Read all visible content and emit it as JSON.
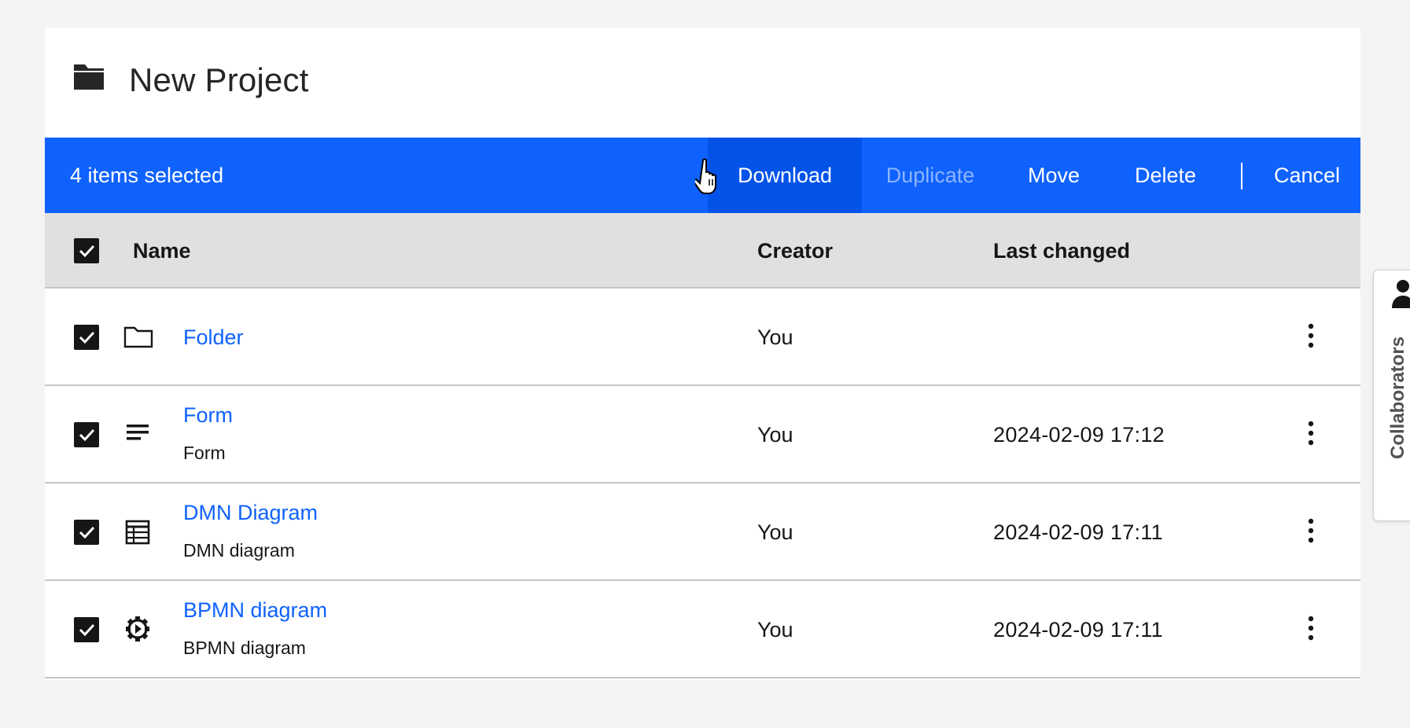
{
  "header": {
    "title": "New Project",
    "icon": "folder-filled-icon"
  },
  "toolbar": {
    "selected_count_text": "4 items selected",
    "download": "Download",
    "duplicate": "Duplicate",
    "move": "Move",
    "delete": "Delete",
    "cancel": "Cancel"
  },
  "table": {
    "headers": {
      "name": "Name",
      "creator": "Creator",
      "last_changed": "Last changed"
    },
    "rows": [
      {
        "name": "Folder",
        "type": "",
        "creator": "You",
        "last_changed": "",
        "icon": "folder-icon"
      },
      {
        "name": "Form",
        "type": "Form",
        "creator": "You",
        "last_changed": "2024-02-09 17:12",
        "icon": "form-icon"
      },
      {
        "name": "DMN Diagram",
        "type": "DMN diagram",
        "creator": "You",
        "last_changed": "2024-02-09 17:11",
        "icon": "table-icon"
      },
      {
        "name": "BPMN diagram",
        "type": "BPMN diagram",
        "creator": "You",
        "last_changed": "2024-02-09 17:11",
        "icon": "bpmn-gear-icon"
      }
    ]
  },
  "side_panel": {
    "label": "Collaborators",
    "icon": "person-icon"
  },
  "colors": {
    "accent": "#0f62fe",
    "link": "#0f62fe",
    "header_bg": "#e0e0e0"
  }
}
